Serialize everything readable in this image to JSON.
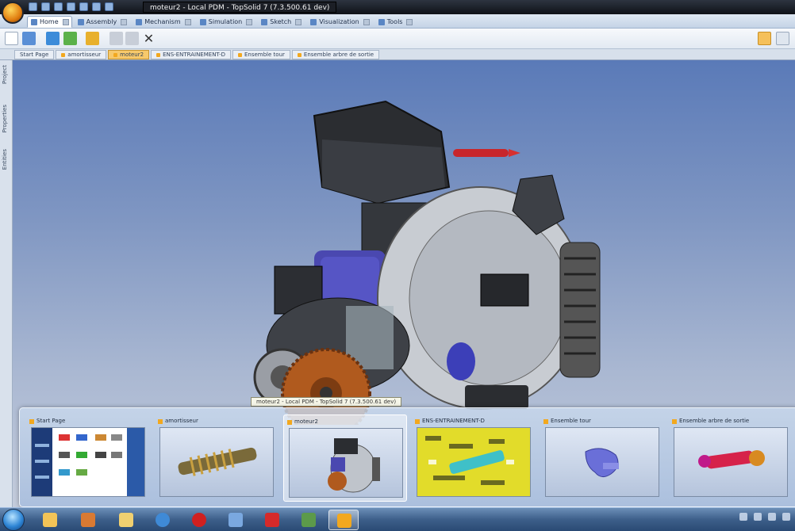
{
  "window": {
    "title": "moteur2 - Local PDM - TopSolid 7 (7.3.500.61 dev)"
  },
  "ribbon_tabs": [
    {
      "label": "Home",
      "active": true
    },
    {
      "label": "Assembly",
      "active": false
    },
    {
      "label": "Mechanism",
      "active": false
    },
    {
      "label": "Simulation",
      "active": false
    },
    {
      "label": "Sketch",
      "active": false
    },
    {
      "label": "Visualization",
      "active": false
    },
    {
      "label": "Tools",
      "active": false
    }
  ],
  "document_tabs": [
    {
      "label": "Start Page",
      "active": false
    },
    {
      "label": "amortisseur",
      "active": false
    },
    {
      "label": "moteur2",
      "active": true
    },
    {
      "label": "ENS-ENTRAINEMENT-D",
      "active": false
    },
    {
      "label": "Ensemble tour",
      "active": false
    },
    {
      "label": "Ensemble arbre de sortie",
      "active": false
    }
  ],
  "side_panels": [
    "Project",
    "Properties",
    "Entities"
  ],
  "tooltip": "moteur2 - Local PDM - TopSolid 7 (7.3.500.61 dev)",
  "previews": [
    {
      "title": "Start Page",
      "active": false
    },
    {
      "title": "amortisseur",
      "active": false
    },
    {
      "title": "moteur2",
      "active": true
    },
    {
      "title": "ENS-ENTRAINEMENT-D",
      "active": false
    },
    {
      "title": "Ensemble tour",
      "active": false
    },
    {
      "title": "Ensemble arbre de sortie",
      "active": false
    }
  ],
  "colors": {
    "viewport_top": "#5a7ab8",
    "viewport_bottom": "#c4ccdc",
    "accent_orange": "#f2a81f",
    "taskbar": "#3d5f8a"
  },
  "taskbar_icons": [
    "start-orb",
    "folder-icon",
    "tools-icon",
    "explorer-icon",
    "ie-icon",
    "red-ball-icon",
    "network-icon",
    "acrobat-icon",
    "device-icon",
    "topsolid-icon"
  ]
}
